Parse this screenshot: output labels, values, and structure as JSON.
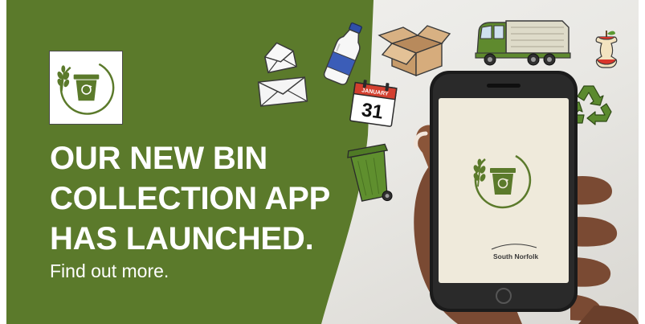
{
  "banner": {
    "headline_lines": [
      "OUR NEW BIN",
      "COLLECTION APP",
      "HAS LAUNCHED."
    ],
    "cta": "Find out more."
  },
  "calendar": {
    "month": "JANUARY",
    "day": "31"
  },
  "phone": {
    "brand": "South Norfolk"
  },
  "colors": {
    "brand_green": "#5b7a2b",
    "white": "#ffffff",
    "calendar_red": "#d33f2f",
    "splash_cream": "#efeadb"
  },
  "icons": [
    "app-logo-icon",
    "envelope-open-icon",
    "envelope-icon",
    "milk-bottle-icon",
    "cardboard-box-icon",
    "bin-lorry-icon",
    "apple-core-icon",
    "calendar-icon",
    "recycle-icon",
    "green-wheelie-bin-icon",
    "smartphone-icon",
    "hand-icon"
  ]
}
